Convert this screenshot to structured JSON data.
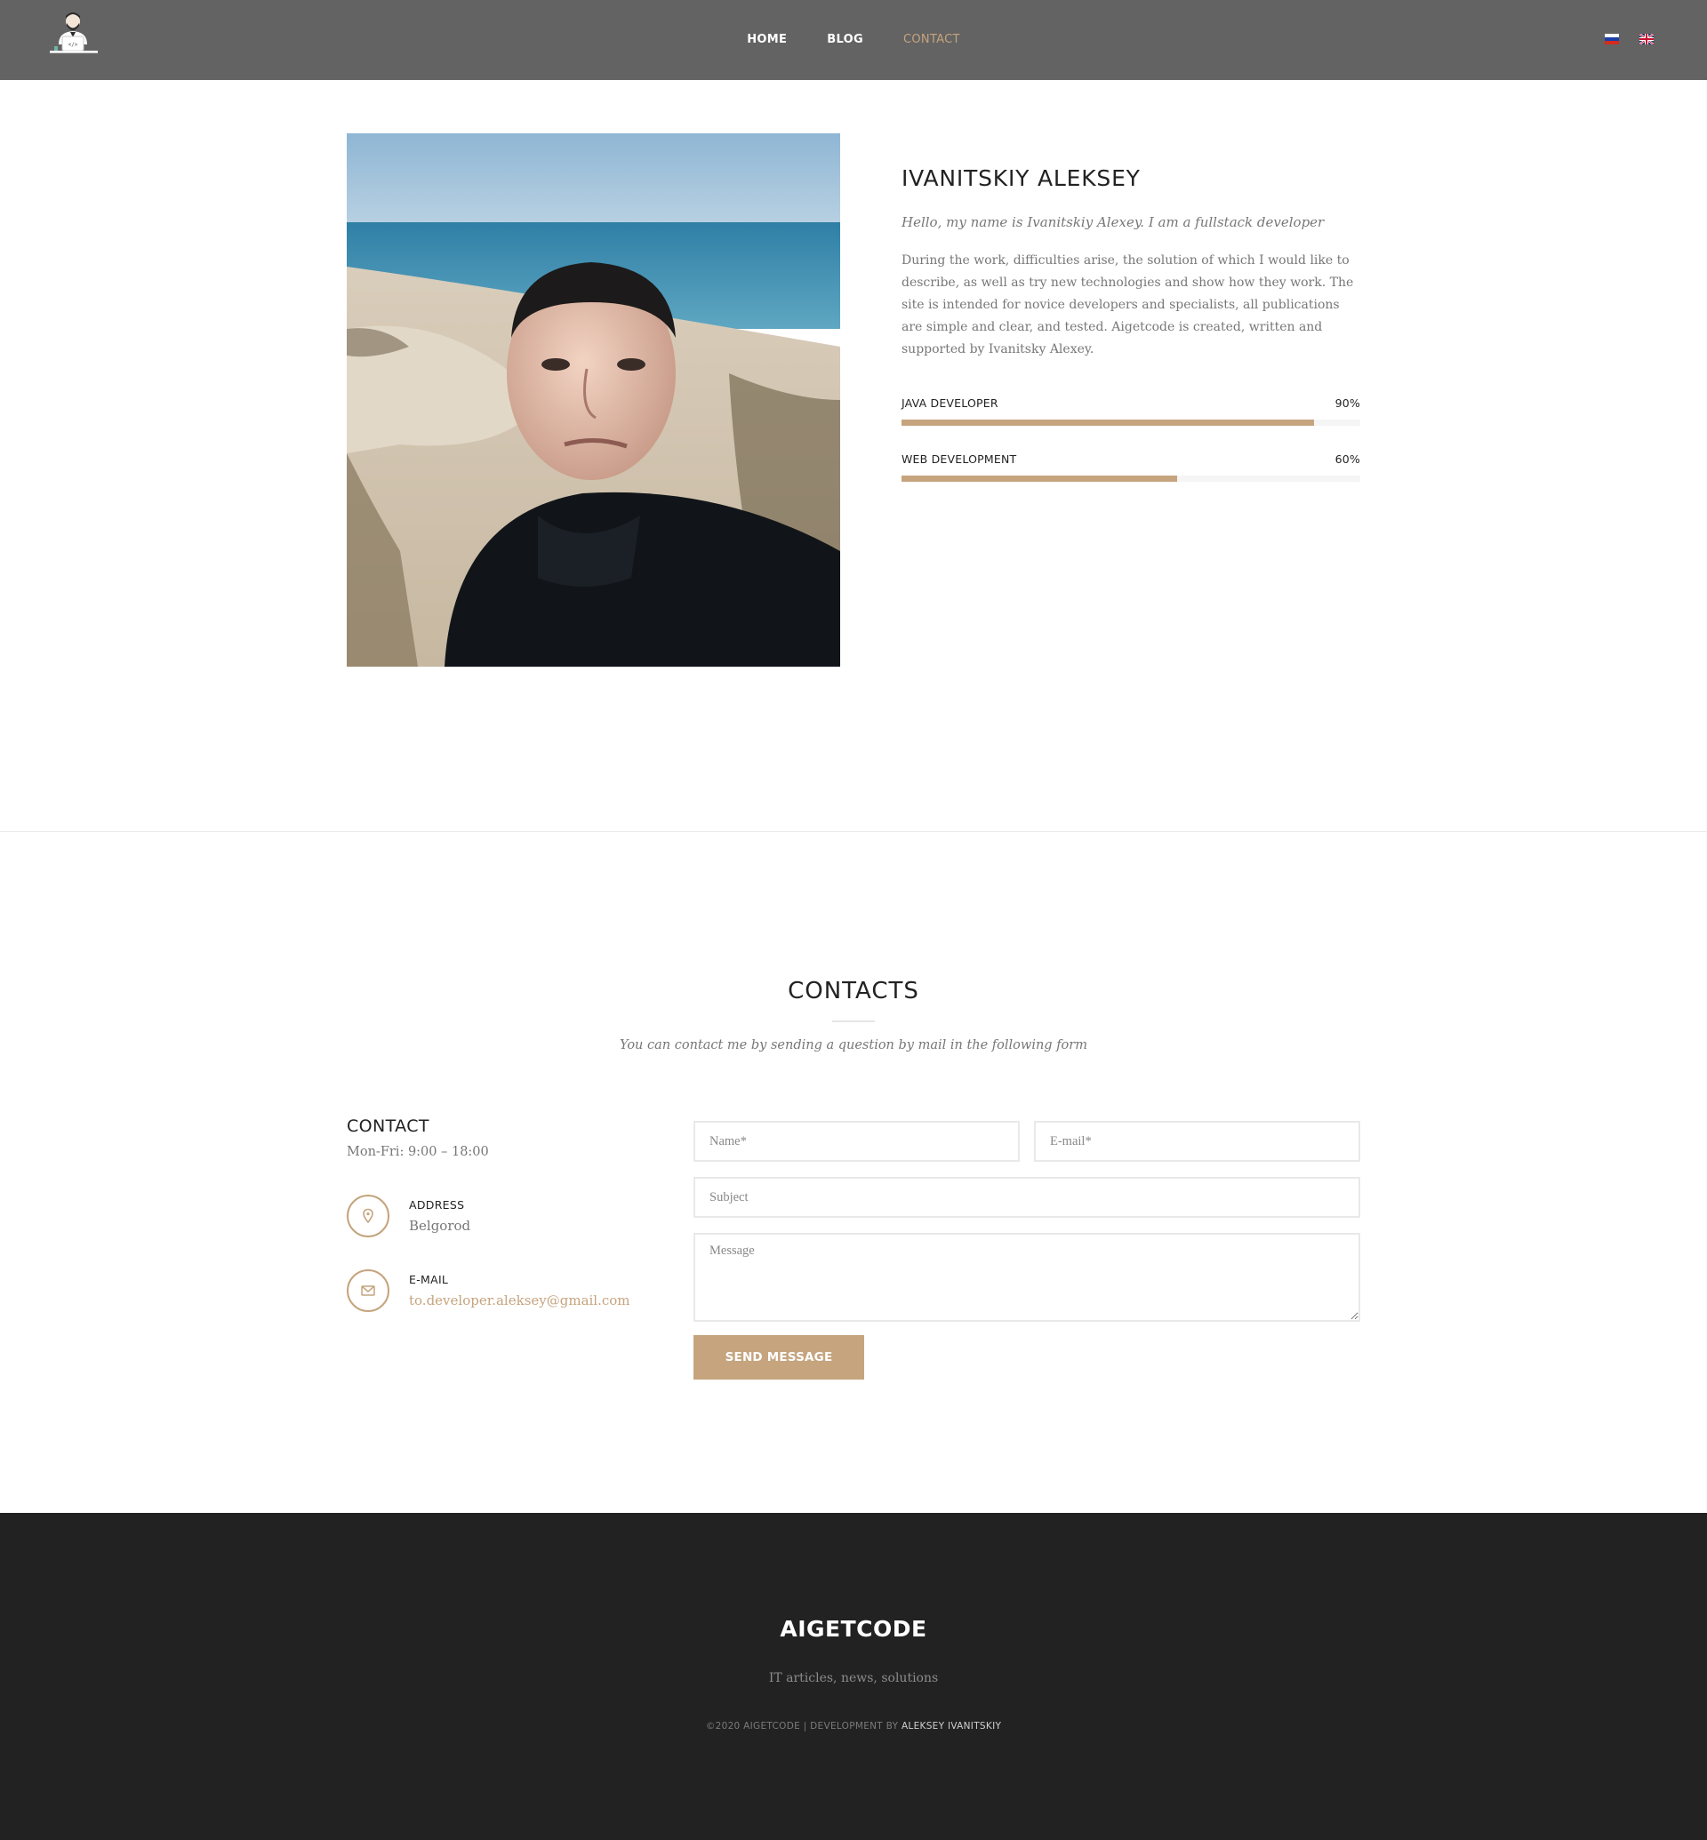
{
  "header": {
    "nav": [
      "HOME",
      "BLOG",
      "CONTACT"
    ],
    "active_nav": "CONTACT",
    "languages": [
      "russian-flag",
      "english-flag"
    ]
  },
  "about": {
    "name": "IVANITSKIY ALEKSEY",
    "lead": "Hello, my name is Ivanitskiy Alexey. I am a fullstack developer",
    "text": "During the work, difficulties arise, the solution of which I would like to describe, as well as try new technologies and show how they work. The site is intended for novice developers and specialists, all publications are simple and clear, and tested. Aigetcode is created, written and supported by Ivanitsky Alexey.",
    "skills": [
      {
        "label": "JAVA DEVELOPER",
        "percent_label": "90%",
        "value": 0.9
      },
      {
        "label": "WEB DEVELOPMENT",
        "percent_label": "60%",
        "value": 0.6
      }
    ]
  },
  "contacts": {
    "title": "CONTACTS",
    "subtitle": "You can contact me by sending a question by mail in the following form",
    "info": {
      "title": "CONTACT",
      "hours": "Mon-Fri: 9:00 – 18:00",
      "address_label": "ADDRESS",
      "address": "Belgorod",
      "email_label": "E-MAIL",
      "email": "to.developer.aleksey@gmail.com"
    },
    "form": {
      "name_placeholder": "Name*",
      "email_placeholder": "E-mail*",
      "subject_placeholder": "Subject",
      "message_placeholder": "Message",
      "send_label": "SEND MESSAGE"
    }
  },
  "footer": {
    "brand": "AIGETCODE",
    "tagline": "IT articles, news, solutions",
    "copyright": "©2020 AIGETCODE | DEVELOPMENT BY ",
    "author": "ALEKSEY IVANITSKIY"
  },
  "colors": {
    "accent": "#c5a47e",
    "header_bg": "#636363",
    "footer_bg": "#222222"
  }
}
